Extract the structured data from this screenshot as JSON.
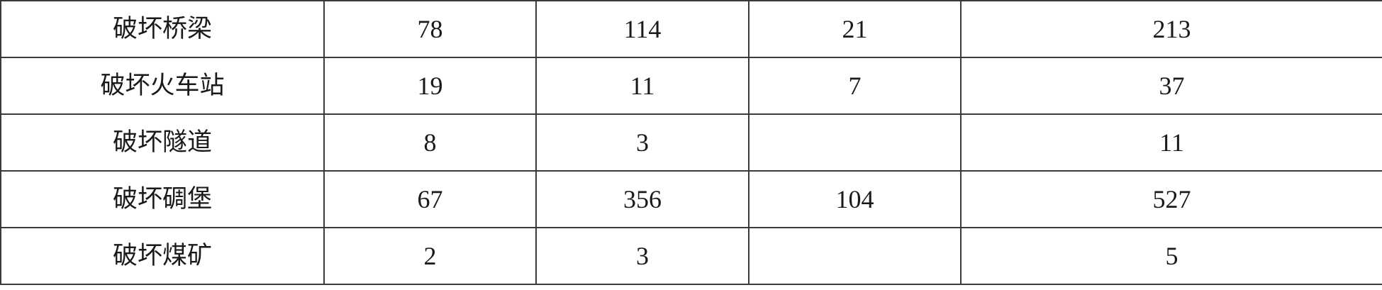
{
  "table": {
    "rows": [
      {
        "label": "破坏桥梁",
        "cells": [
          "78",
          "114",
          "21",
          "213"
        ]
      },
      {
        "label": "破坏火车站",
        "cells": [
          "19",
          "11",
          "7",
          "37"
        ]
      },
      {
        "label": "破坏隧道",
        "cells": [
          "8",
          "3",
          "",
          "11"
        ]
      },
      {
        "label": "破坏碉堡",
        "cells": [
          "67",
          "356",
          "104",
          "527"
        ]
      },
      {
        "label": "破坏煤矿",
        "cells": [
          "2",
          "3",
          "",
          "5"
        ]
      }
    ]
  }
}
